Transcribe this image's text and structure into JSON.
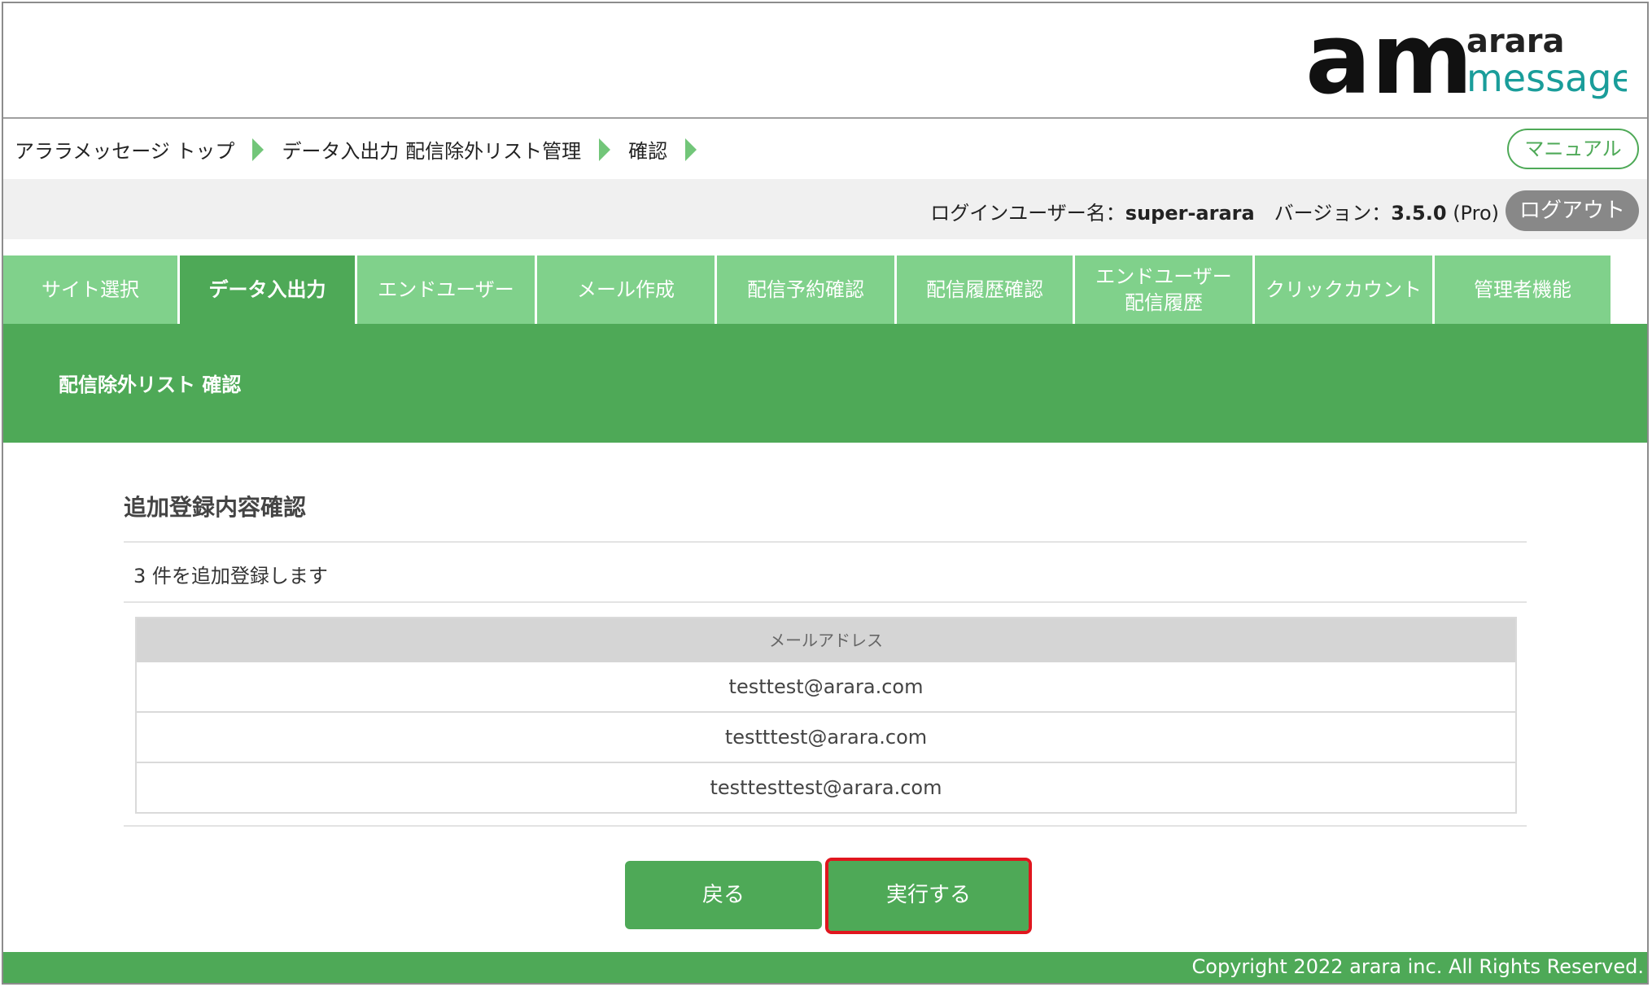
{
  "brand": {
    "logo_mark": "am",
    "logo_line1": "arara",
    "logo_line2": "message",
    "colors": {
      "dark": "#111111",
      "teal": "#1a9d9a"
    }
  },
  "breadcrumb": {
    "items": [
      "アララメッセージ トップ",
      "データ入出力 配信除外リスト管理",
      "確認"
    ]
  },
  "manual_label": "マニュアル",
  "userbar": {
    "user_label": "ログインユーザー名：",
    "user_name": "super-arara",
    "version_label": "バージョン：",
    "version": "3.5.0",
    "edition": "(Pro)",
    "logout_label": "ログアウト"
  },
  "tabs": [
    {
      "label": "サイト選択"
    },
    {
      "label": "データ入出力"
    },
    {
      "label": "エンドユーザー"
    },
    {
      "label": "メール作成"
    },
    {
      "label": "配信予約確認"
    },
    {
      "label": "配信履歴確認"
    },
    {
      "label": "エンドユーザー\n配信履歴"
    },
    {
      "label": "クリックカウント"
    },
    {
      "label": "管理者機能"
    }
  ],
  "page_title": "配信除外リスト 確認",
  "section_title": "追加登録内容確認",
  "count_text": "3 件を追加登録します",
  "table": {
    "header": "メールアドレス",
    "rows": [
      "testtest@arara.com",
      "testttest@arara.com",
      "testtesttest@arara.com"
    ]
  },
  "buttons": {
    "back": "戻る",
    "execute": "実行する"
  },
  "footer": "Copyright 2022 arara inc. All Rights Reserved.",
  "colors": {
    "green": "#4ea957",
    "tab_green": "#80d18b",
    "highlight": "#e0161e"
  }
}
